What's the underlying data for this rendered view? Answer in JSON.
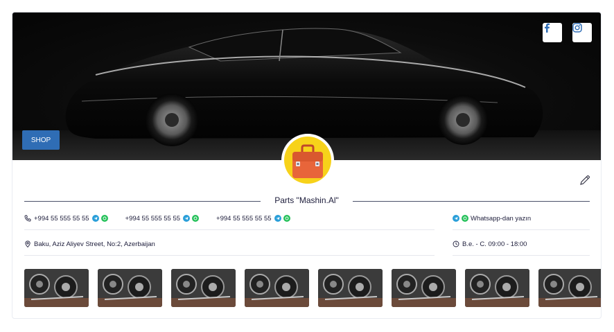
{
  "social": {
    "facebook_icon": "facebook-icon",
    "instagram_icon": "instagram-icon"
  },
  "banner": {
    "shop_label": "SHOP"
  },
  "store": {
    "title": "Parts \"Mashin.Al\""
  },
  "contacts": {
    "phones": [
      "+994 55 555 55 55",
      "+994 55 555 55 55",
      "+994 55 555 55 55"
    ],
    "whatsapp_label": "Whatsapp-dan yazın",
    "address": "Baku, Aziz Aliyev Street, No:2, Azerbaijan",
    "hours": "B.e. - C. 09:00 - 18:00"
  },
  "gallery": {
    "count_visible": 8
  },
  "colors": {
    "accent": "#2f6db5",
    "telegram": "#2a9fd9",
    "whatsapp": "#25c15a",
    "avatar_bg": "#f7d21a",
    "briefcase": "#e8653a"
  }
}
